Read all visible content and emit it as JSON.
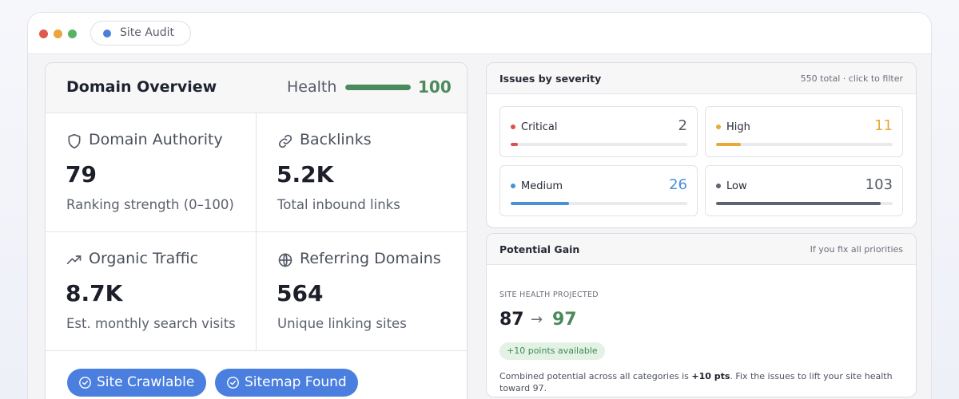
{
  "window": {
    "tab_label": "Site Audit"
  },
  "overview": {
    "title": "Domain Overview",
    "health_label": "Health",
    "health_value": "100",
    "health_percent": 100,
    "metrics": [
      {
        "icon": "shield-icon",
        "label": "Domain Authority",
        "value": "79",
        "sub": "Ranking strength (0–100)"
      },
      {
        "icon": "link-icon",
        "label": "Backlinks",
        "value": "5.2K",
        "sub": "Total inbound links"
      },
      {
        "icon": "trending-up-icon",
        "label": "Organic Traffic",
        "value": "8.7K",
        "sub": "Est. monthly search visits"
      },
      {
        "icon": "globe-icon",
        "label": "Referring Domains",
        "value": "564",
        "sub": "Unique linking sites"
      }
    ],
    "pills": [
      {
        "icon": "check-circle-icon",
        "label": "Site Crawlable"
      },
      {
        "icon": "check-circle-icon",
        "label": "Sitemap Found"
      }
    ]
  },
  "severity": {
    "title": "Issues by severity",
    "meta": "550 total · click to filter",
    "items": [
      {
        "label": "Critical",
        "count": "2",
        "fraction": 0.04,
        "color": "#d9534f",
        "count_color": "#555a66"
      },
      {
        "label": "High",
        "count": "11",
        "fraction": 0.14,
        "color": "#e8a93b",
        "count_color": "#e8a93b"
      },
      {
        "label": "Medium",
        "count": "26",
        "fraction": 0.33,
        "color": "#4a90d9",
        "count_color": "#4a90d9"
      },
      {
        "label": "Low",
        "count": "103",
        "fraction": 0.93,
        "color": "#5f6270",
        "count_color": "#555a66"
      }
    ]
  },
  "gain": {
    "title": "Potential Gain",
    "meta": "If you fix all priorities",
    "eyebrow": "SITE HEALTH PROJECTED",
    "from": "87",
    "arrow": "→",
    "to": "97",
    "badge": "+10 points available",
    "desc_before": "Combined potential across all categories is ",
    "desc_bold": "+10 pts",
    "desc_after": ". Fix the issues to lift your site health toward 97."
  }
}
